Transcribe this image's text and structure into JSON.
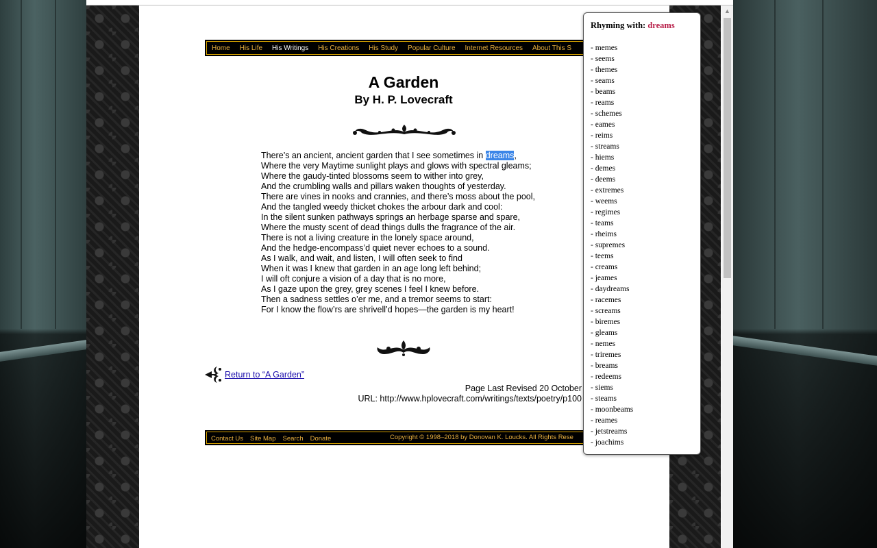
{
  "nav": {
    "items": [
      {
        "label": "Home",
        "active": false
      },
      {
        "label": "His Life",
        "active": false
      },
      {
        "label": "His Writings",
        "active": true
      },
      {
        "label": "His Creations",
        "active": false
      },
      {
        "label": "His Study",
        "active": false
      },
      {
        "label": "Popular Culture",
        "active": false
      },
      {
        "label": "Internet Resources",
        "active": false
      },
      {
        "label": "About This S",
        "active": false
      }
    ]
  },
  "page": {
    "title": "A Garden",
    "author": "By H. P. Lovecraft"
  },
  "poem": {
    "highlight_word": "dreams",
    "first_line_before": "There’s an ancient, ancient garden that I see sometimes in ",
    "first_line_after": ",",
    "lines": [
      "Where the very Maytime sunlight plays and glows with spectral gleams;",
      "Where the gaudy-tinted blossoms seem to wither into grey,",
      "And the crumbling walls and pillars waken thoughts of yesterday.",
      "There are vines in nooks and crannies, and there’s moss about the pool,",
      "And the tangled weedy thicket chokes the arbour dark and cool:",
      "In the silent sunken pathways springs an herbage sparse and spare,",
      "Where the musty scent of dead things dulls the fragrance of the air.",
      "There is not a living creature in the lonely space around,",
      "And the hedge-encompass’d quiet never echoes to a sound.",
      "As I walk, and wait, and listen, I will often seek to find",
      "When it was I knew that garden in an age long left behind;",
      "I will oft conjure a vision of a day that is no more,",
      "As I gaze upon the grey, grey scenes I feel I knew before.",
      "Then a sadness settles o’er me, and a tremor seems to start:",
      "For I know the flow’rs are shrivell’d hopes—the garden is my heart!"
    ]
  },
  "return_link": "Return to “A Garden”",
  "revised": "Page Last Revised 20 October",
  "url": "URL: http://www.hplovecraft.com/writings/texts/poetry/p100",
  "footer": {
    "links": [
      "Contact Us",
      "Site Map",
      "Search",
      "Donate"
    ],
    "copyright": "Copyright © 1998–2018 by Donovan K. Loucks. All Rights Rese"
  },
  "rhyme_popup": {
    "label": "Rhyming with:",
    "word": "dreams",
    "rhymes": [
      "- memes",
      "- seems",
      "- themes",
      "- seams",
      "- beams",
      "- reams",
      "- schemes",
      "- eames",
      "- reims",
      "- streams",
      "- hiems",
      "- demes",
      "- deems",
      "- extremes",
      "- weems",
      "- regimes",
      "- teams",
      "- rheims",
      "- supremes",
      "- teems",
      "- creams",
      "- jeames",
      "- daydreams",
      "- racemes",
      "- screams",
      "- biremes",
      "- gleams",
      "- nemes",
      "- triremes",
      "- breams",
      "- redeems",
      "- siems",
      "- steams",
      "- moonbeams",
      "- reames",
      "- jetstreams",
      "- joachims"
    ]
  },
  "colors": {
    "nav_text": "#e8b040",
    "nav_active": "#ffffff",
    "highlight_bg": "#3b86e8",
    "popup_word": "#b8204a",
    "link": "#1a0dab"
  }
}
